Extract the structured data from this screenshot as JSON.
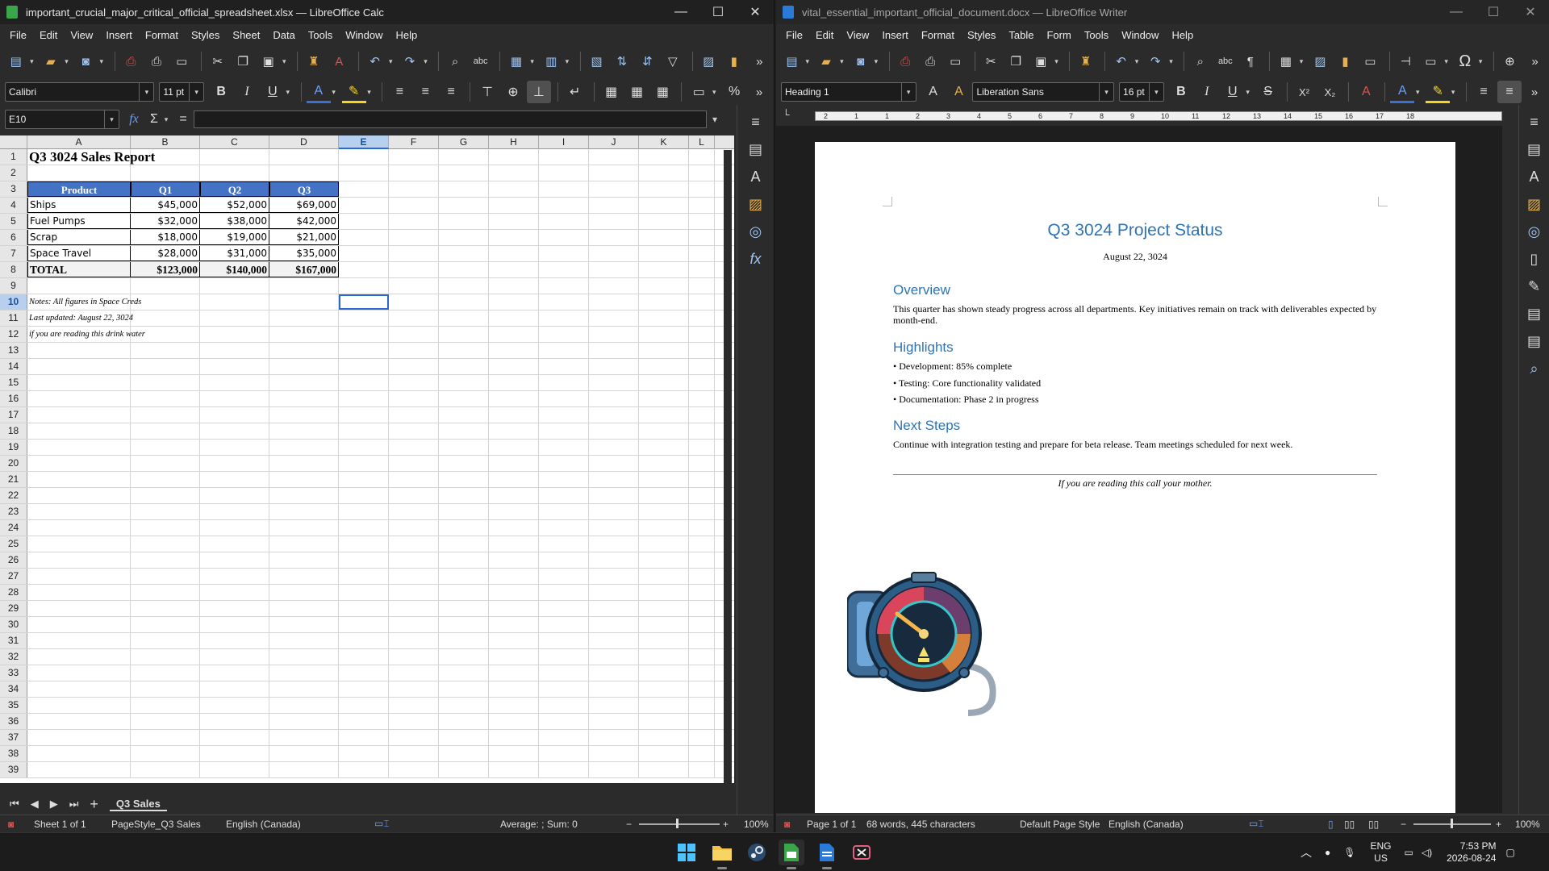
{
  "calc": {
    "title": "important_crucial_major_critical_official_spreadsheet.xlsx — LibreOffice Calc",
    "menu": [
      "File",
      "Edit",
      "View",
      "Insert",
      "Format",
      "Styles",
      "Sheet",
      "Data",
      "Tools",
      "Window",
      "Help"
    ],
    "font_name": "Calibri",
    "font_size": "11 pt",
    "name_box": "E10",
    "columns": [
      "A",
      "B",
      "C",
      "D",
      "E",
      "F",
      "G",
      "H",
      "I",
      "J",
      "K",
      "L"
    ],
    "selected_column": "E",
    "selected_row": "10",
    "report_title": "Q3 3024 Sales Report",
    "table_headers": [
      "Product",
      "Q1",
      "Q2",
      "Q3"
    ],
    "table_rows": [
      [
        "Ships",
        "$45,000",
        "$52,000",
        "$69,000"
      ],
      [
        "Fuel Pumps",
        "$32,000",
        "$38,000",
        "$42,000"
      ],
      [
        "Scrap",
        "$18,000",
        "$19,000",
        "$21,000"
      ],
      [
        "Space Travel",
        "$28,000",
        "$31,000",
        "$35,000"
      ]
    ],
    "total_row": [
      "TOTAL",
      "$123,000",
      "$140,000",
      "$167,000"
    ],
    "notes": [
      "Notes: All figures in Space Creds",
      "Last updated: August 22, 3024",
      "if you are reading this drink water"
    ],
    "sheet_tab": "Q3 Sales",
    "status": {
      "sheet": "Sheet 1 of 1",
      "page_style": "PageStyle_Q3 Sales",
      "language": "English (Canada)",
      "sum": "Average: ; Sum: 0",
      "zoom": "100%"
    }
  },
  "writer": {
    "title": "vital_essential_important_official_document.docx — LibreOffice Writer",
    "menu": [
      "File",
      "Edit",
      "View",
      "Insert",
      "Format",
      "Styles",
      "Table",
      "Form",
      "Tools",
      "Window",
      "Help"
    ],
    "paragraph_style": "Heading 1",
    "font_name": "Liberation Sans",
    "font_size": "16 pt",
    "ruler_marks": [
      "2",
      "1",
      "1",
      "2",
      "3",
      "4",
      "5",
      "6",
      "7",
      "8",
      "9",
      "10",
      "11",
      "12",
      "13",
      "14",
      "15",
      "16",
      "17",
      "18"
    ],
    "doc": {
      "title": "Q3 3024 Project Status",
      "date": "August 22, 3024",
      "overview_heading": "Overview",
      "overview_text": "This quarter has shown steady progress across all departments. Key initiatives remain on track with deliverables expected by month-end.",
      "highlights_heading": "Highlights",
      "highlights": [
        "• Development: 85% complete",
        "• Testing: Core functionality validated",
        "• Documentation: Phase 2 in progress"
      ],
      "next_heading": "Next Steps",
      "next_text": "Continue with integration testing and prepare for beta release. Team meetings scheduled for next week.",
      "footer_note": "If you are reading this call your mother."
    },
    "status": {
      "page": "Page 1 of 1",
      "words": "68 words, 445 characters",
      "page_style": "Default Page Style",
      "language": "English (Canada)",
      "zoom": "100%"
    }
  },
  "taskbar": {
    "lang_top": "ENG",
    "lang_bottom": "US",
    "time": "7:53 PM",
    "date": "2026-08-24"
  }
}
